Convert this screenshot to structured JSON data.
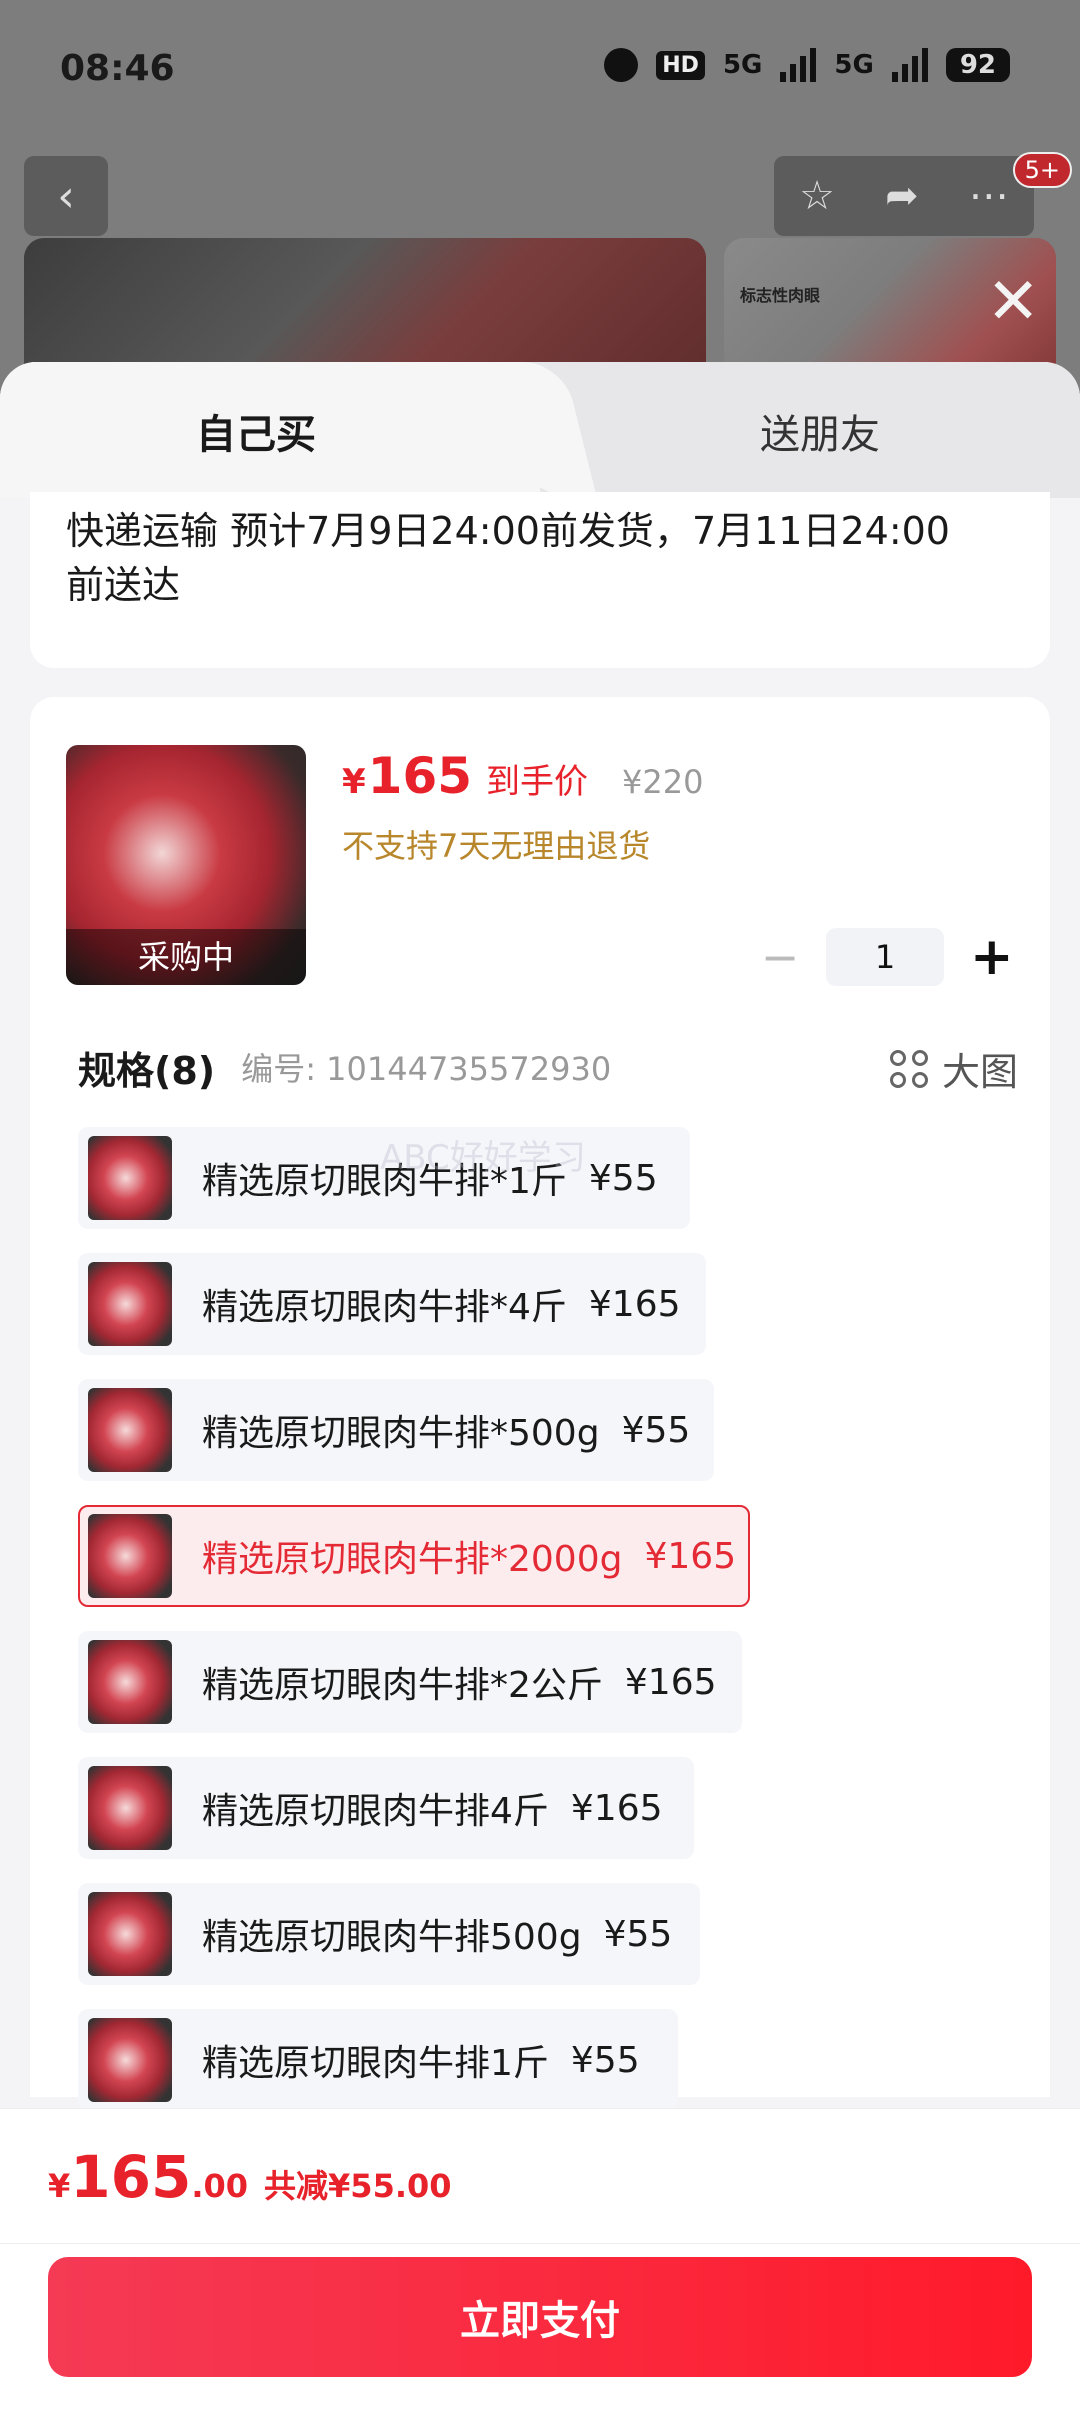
{
  "status_bar": {
    "time": "08:46",
    "hd": "HD",
    "net1": "5G",
    "net2": "5G",
    "battery": "92"
  },
  "nav": {
    "badge": "5+"
  },
  "hero": {
    "caption": "标志性肉眼"
  },
  "tabs": {
    "self_buy": "自己买",
    "gift_friend": "送朋友"
  },
  "delivery": {
    "text": "快递运输 预计7月9日24:00前发货，7月11日24:00前送达"
  },
  "product": {
    "thumb_overlay": "采购中",
    "currency": "¥",
    "price": "165",
    "price_tag": "到手价",
    "original_price": "¥220",
    "return_note": "不支持7天无理由退货",
    "quantity": "1"
  },
  "spec_header": {
    "title": "规格(8)",
    "code": "编号: 10144735572930",
    "big_image": "大图"
  },
  "specs": [
    {
      "name": "精选原切眼肉牛排*1斤",
      "price": "¥55",
      "selected": false
    },
    {
      "name": "精选原切眼肉牛排*4斤",
      "price": "¥165",
      "selected": false
    },
    {
      "name": "精选原切眼肉牛排*500g",
      "price": "¥55",
      "selected": false
    },
    {
      "name": "精选原切眼肉牛排*2000g",
      "price": "¥165",
      "selected": true
    },
    {
      "name": "精选原切眼肉牛排*2公斤",
      "price": "¥165",
      "selected": false
    },
    {
      "name": "精选原切眼肉牛排4斤",
      "price": "¥165",
      "selected": false
    },
    {
      "name": "精选原切眼肉牛排500g",
      "price": "¥55",
      "selected": false
    },
    {
      "name": "精选原切眼肉牛排1斤",
      "price": "¥55",
      "selected": false
    }
  ],
  "watermark": "ABC好好学习",
  "footer": {
    "currency": "¥",
    "total_int": "165",
    "total_dec": ".00",
    "discount": "共减¥55.00",
    "pay_button": "立即支付"
  },
  "colors": {
    "accent": "#e8222b",
    "return_note": "#b8862b",
    "pay_button_start": "#f53a55",
    "pay_button_end": "#ff1a2a"
  }
}
